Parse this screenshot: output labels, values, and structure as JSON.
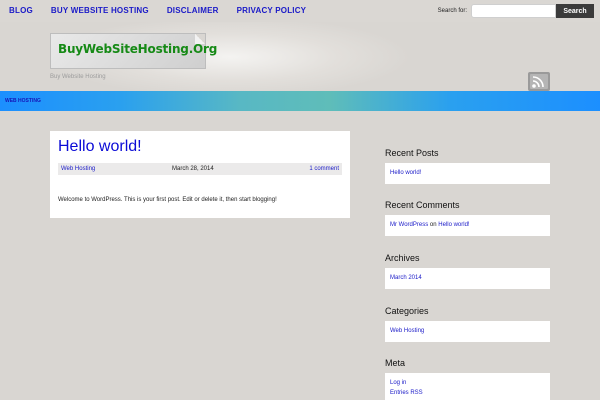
{
  "nav": {
    "items": [
      "BLOG",
      "BUY WEBSITE HOSTING",
      "DISCLAIMER",
      "PRIVACY POLICY"
    ]
  },
  "search": {
    "label": "Search for:",
    "value": "",
    "button": "Search"
  },
  "header": {
    "logo_text": "BuyWebSiteHosting.Org",
    "tagline": "Buy Website Hosting"
  },
  "category_bar": {
    "item": "WEB HOSTING"
  },
  "post": {
    "title": "Hello world!",
    "category": "Web Hosting",
    "date": "March 28, 2014",
    "comments": "1 comment",
    "body": "Welcome to WordPress. This is your first post. Edit or delete it, then start blogging!"
  },
  "sidebar": {
    "recent_posts": {
      "title": "Recent Posts",
      "items": [
        "Hello world!"
      ]
    },
    "recent_comments": {
      "title": "Recent Comments",
      "author": "Mr WordPress",
      "on": " on ",
      "post": "Hello world!"
    },
    "archives": {
      "title": "Archives",
      "items": [
        "March 2014"
      ]
    },
    "categories": {
      "title": "Categories",
      "items": [
        "Web Hosting"
      ]
    },
    "meta": {
      "title": "Meta",
      "items": [
        "Log in",
        "Entries RSS"
      ]
    }
  },
  "colors": {
    "link": "#1a1ac8",
    "title_blue": "#0b0bd6",
    "category_bar": "#1c8fff",
    "logo_green": "#168a16",
    "background": "#d9d6d2"
  },
  "icons": {
    "feed": "rss-icon"
  }
}
